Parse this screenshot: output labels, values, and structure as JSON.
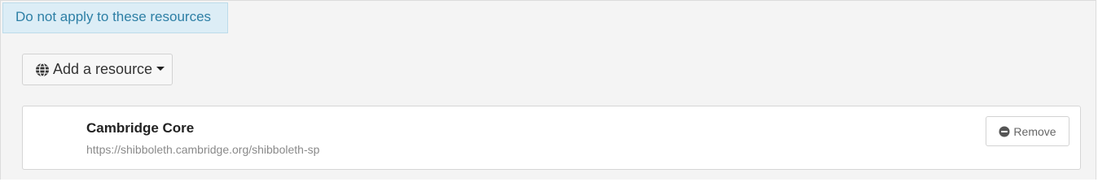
{
  "section": {
    "header": "Do not apply to these resources"
  },
  "toolbar": {
    "add_resource_label": "Add a resource",
    "add_resource_icon": "globe-icon",
    "dropdown_icon": "caret-down-icon"
  },
  "resources": [
    {
      "name": "Cambridge Core",
      "url": "https://shibboleth.cambridge.org/shibboleth-sp",
      "remove_label": "Remove",
      "remove_icon": "minus-circle-icon"
    }
  ],
  "colors": {
    "header_bg": "#dcedf6",
    "header_text": "#2d7fa5",
    "panel_bg": "#f4f4f4"
  }
}
